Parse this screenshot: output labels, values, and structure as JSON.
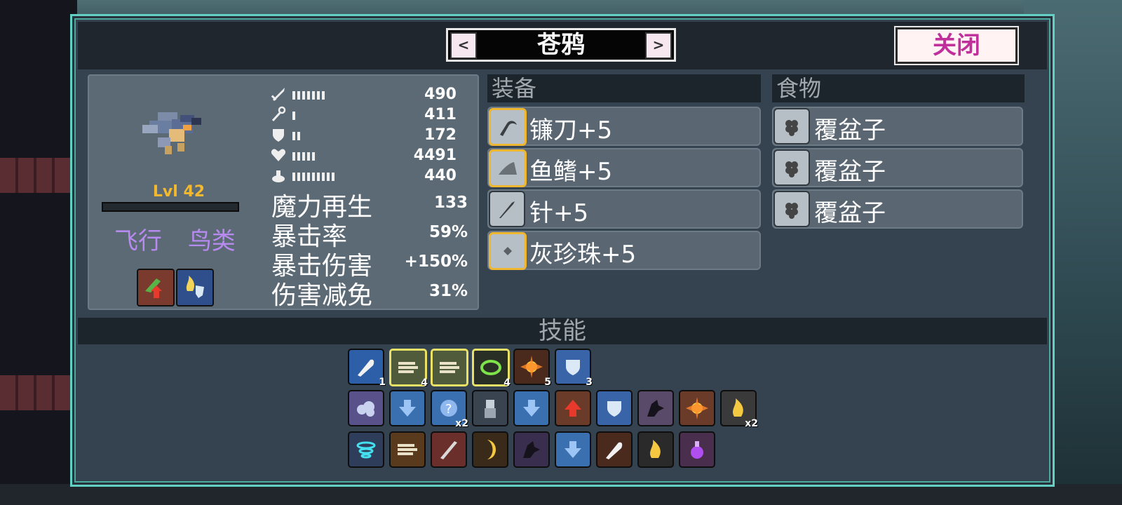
{
  "header": {
    "character_name": "苍鸦",
    "prev_label": "<",
    "next_label": ">",
    "close_label": "关闭"
  },
  "character": {
    "level": "Lvl 42",
    "xp_fill": 0,
    "traits": [
      "飞行",
      "鸟类"
    ],
    "buffs": [
      {
        "icon": "leaf-up-arrow-icon",
        "color": "#7a3b2e"
      },
      {
        "icon": "flame-shield-icon",
        "color": "#2f4e8c"
      }
    ]
  },
  "stats": [
    {
      "icon": "sword-icon",
      "pips": 7,
      "value": "490"
    },
    {
      "icon": "staff-icon",
      "pips": 1,
      "value": "411"
    },
    {
      "icon": "shield-icon",
      "pips": 2,
      "value": "172"
    },
    {
      "icon": "heart-icon",
      "pips": 5,
      "value": "4491"
    },
    {
      "icon": "speed-icon",
      "pips": 9,
      "value": "440"
    }
  ],
  "big_stats": [
    {
      "label": "魔力再生",
      "value": "133"
    },
    {
      "label": "暴击率",
      "value": "59%"
    },
    {
      "label": "暴击伤害",
      "value": "+150%"
    },
    {
      "label": "伤害减免",
      "value": "31%"
    }
  ],
  "equipment": {
    "title": "装备",
    "items": [
      {
        "label": "镰刀+5",
        "icon": "sickle-icon"
      },
      {
        "label": "鱼鳍+5",
        "icon": "fin-icon"
      },
      {
        "label": "针+5",
        "icon": "needle-icon"
      },
      {
        "label": "灰珍珠+5",
        "icon": "pearl-icon"
      }
    ]
  },
  "food": {
    "title": "食物",
    "items": [
      {
        "label": "覆盆子",
        "icon": "raspberry-icon"
      },
      {
        "label": "覆盆子",
        "icon": "raspberry-icon"
      },
      {
        "label": "覆盆子",
        "icon": "raspberry-icon"
      }
    ]
  },
  "skills": {
    "title": "技能",
    "rows": [
      [
        {
          "icon": "blue-feather-icon",
          "color": "#2c5fa8",
          "count": "1",
          "hl": false
        },
        {
          "icon": "wind-slash-icon",
          "color": "#4f5b3a",
          "count": "4",
          "hl": true
        },
        {
          "icon": "double-wind-icon",
          "color": "#4f5b3a",
          "count": "",
          "hl": true
        },
        {
          "icon": "green-ring-icon",
          "color": "#2a2f26",
          "count": "4",
          "hl": true
        },
        {
          "icon": "explosion-icon",
          "color": "#4a2a1c",
          "count": "5",
          "hl": false
        },
        {
          "icon": "ice-shield-icon",
          "color": "#3a64a8",
          "count": "3",
          "hl": false
        }
      ],
      [
        {
          "icon": "frost-cloud-icon",
          "color": "#59518a",
          "count": "",
          "hl": false
        },
        {
          "icon": "arrow-down-orb-icon",
          "color": "#3a6fb0",
          "count": "",
          "hl": false
        },
        {
          "icon": "question-orb-icon",
          "color": "#3a6fb0",
          "count": "x2",
          "hl": false
        },
        {
          "icon": "knight-icon",
          "color": "#3a4350",
          "count": "",
          "hl": false
        },
        {
          "icon": "blue-arrow-down-icon",
          "color": "#3a6fb0",
          "count": "",
          "hl": false
        },
        {
          "icon": "fire-up-arrow-icon",
          "color": "#6b3b2a",
          "count": "",
          "hl": false
        },
        {
          "icon": "spark-shield-icon",
          "color": "#3a64a8",
          "count": "",
          "hl": false
        },
        {
          "icon": "raven-icon",
          "color": "#5a4a6a",
          "count": "",
          "hl": false
        },
        {
          "icon": "burst-orb-icon",
          "color": "#6b3b2a",
          "count": "",
          "hl": false
        },
        {
          "icon": "fire-dash-icon",
          "color": "#3a3a3a",
          "count": "x2",
          "hl": false
        }
      ],
      [
        {
          "icon": "cyan-vortex-icon",
          "color": "#2e3e5a",
          "count": "",
          "hl": false
        },
        {
          "icon": "dash-fist-icon",
          "color": "#5a3a1c",
          "count": "",
          "hl": false
        },
        {
          "icon": "blade-icon",
          "color": "#6a2f2a",
          "count": "",
          "hl": false
        },
        {
          "icon": "crescent-icon",
          "color": "#3a2a1a",
          "count": "",
          "hl": false
        },
        {
          "icon": "wolf-howl-icon",
          "color": "#3a2e4e",
          "count": "",
          "hl": false
        },
        {
          "icon": "blue-arrows-icon",
          "color": "#3a6fb0",
          "count": "",
          "hl": false
        },
        {
          "icon": "gold-feather-icon",
          "color": "#4a2a1c",
          "count": "",
          "hl": false
        },
        {
          "icon": "flame-a-icon",
          "color": "#2a2a2a",
          "count": "",
          "hl": false
        },
        {
          "icon": "purple-potion-icon",
          "color": "#4a2e4e",
          "count": "",
          "hl": false
        }
      ]
    ]
  }
}
